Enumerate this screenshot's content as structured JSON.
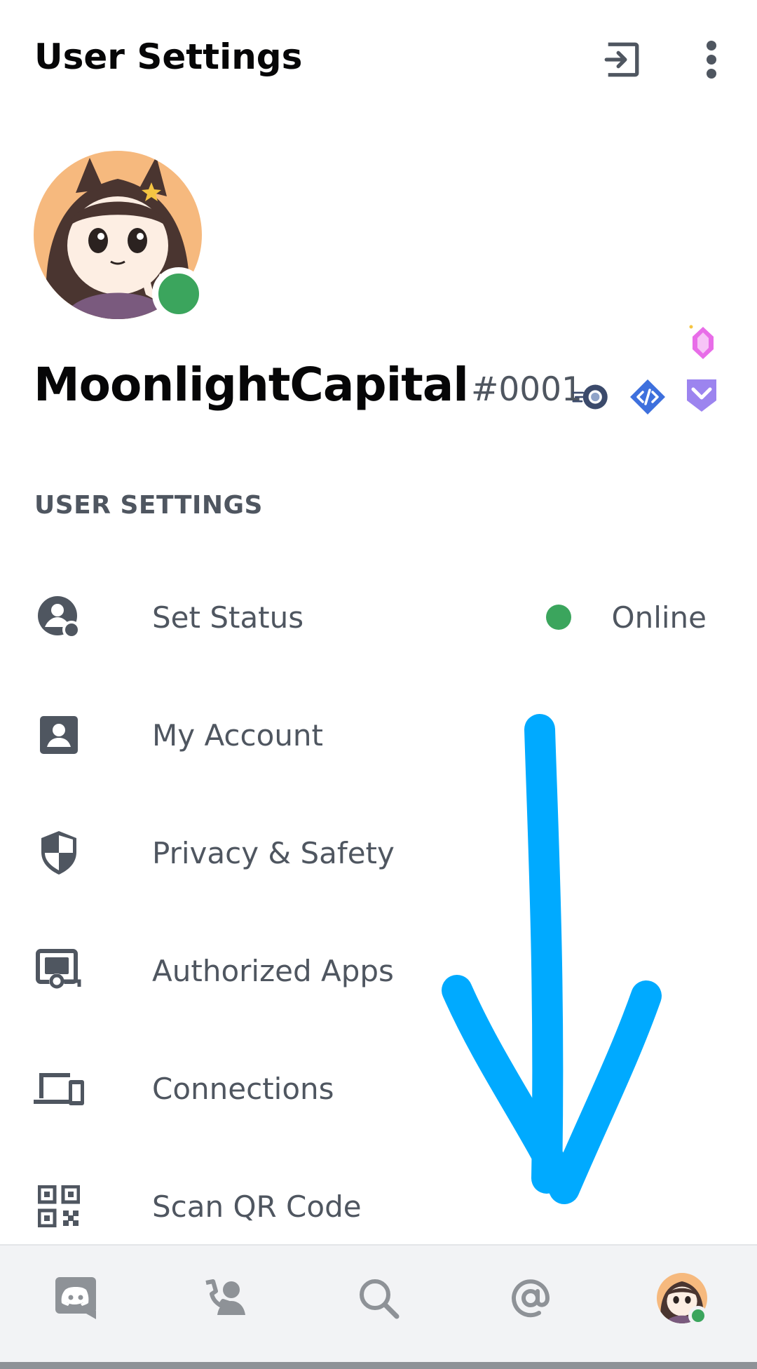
{
  "header": {
    "title": "User Settings",
    "logout_icon": "logout-icon",
    "more_icon": "more-vertical-icon"
  },
  "profile": {
    "username": "MoonlightCapital",
    "discriminator": "#0001",
    "status_color": "#3ba55d",
    "badges": [
      "hypesquad-icon",
      "developer-icon",
      "nitro-boost-gem-icon",
      "early-supporter-icon"
    ]
  },
  "section": {
    "label": "USER SETTINGS"
  },
  "menu": [
    {
      "label": "Set Status",
      "icon": "set-status-icon",
      "value": "Online"
    },
    {
      "label": "My Account",
      "icon": "account-card-icon"
    },
    {
      "label": "Privacy & Safety",
      "icon": "shield-icon"
    },
    {
      "label": "Authorized Apps",
      "icon": "authorized-apps-icon"
    },
    {
      "label": "Connections",
      "icon": "devices-icon"
    },
    {
      "label": "Scan QR Code",
      "icon": "qr-code-icon"
    }
  ],
  "bottom_nav": [
    "discord-home-icon",
    "friends-icon",
    "search-icon",
    "mentions-icon",
    "profile-avatar"
  ],
  "colors": {
    "accent_green": "#3ba55d",
    "annotation_arrow": "#00aaff",
    "text_muted": "#4f5660"
  }
}
